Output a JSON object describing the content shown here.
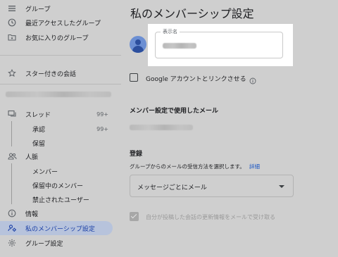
{
  "sidebar": {
    "items": [
      {
        "id": "groups",
        "label": "グループ",
        "icon": "groups-icon"
      },
      {
        "id": "recent",
        "label": "最近アクセスしたグループ",
        "icon": "clock-icon"
      },
      {
        "id": "favorites",
        "label": "お気に入りのグループ",
        "icon": "folder-star-icon"
      },
      {
        "id": "starred",
        "label": "スター付きの会話",
        "icon": "star-icon"
      },
      {
        "id": "threads",
        "label": "スレッド",
        "icon": "threads-icon",
        "count": "99+"
      },
      {
        "id": "approval",
        "label": "承認",
        "count": "99+"
      },
      {
        "id": "pending",
        "label": "保留"
      },
      {
        "id": "people",
        "label": "人脈",
        "icon": "people-icon"
      },
      {
        "id": "members",
        "label": "メンバー"
      },
      {
        "id": "pending-members",
        "label": "保留中のメンバー"
      },
      {
        "id": "banned",
        "label": "禁止されたユーザー"
      },
      {
        "id": "info",
        "label": "情報",
        "icon": "info-icon"
      },
      {
        "id": "my-membership",
        "label": "私のメンバーシップ設定",
        "icon": "membership-icon",
        "active": true
      },
      {
        "id": "group-settings",
        "label": "グループ設定",
        "icon": "gear-icon"
      }
    ]
  },
  "main": {
    "title": "私のメンバーシップ設定",
    "display_name_label": "表示名",
    "link_account_label": "Google アカウントとリンクさせる",
    "email_section_title": "メンバー設定で使用したメール",
    "subscription": {
      "title": "登録",
      "description": "グループからのメールの受信方法を選択します。",
      "details_link": "詳細",
      "selected": "メッセージごとにメール"
    },
    "auto_subscribe_label": "自分が投稿した会話の更新情報をメールで受け取る"
  },
  "colors": {
    "background": "#cfcfcf",
    "active_bg": "#b7c3dc",
    "active_text": "#1a3fa6",
    "link": "#1a56c4",
    "avatar": "#6c8fd3"
  }
}
